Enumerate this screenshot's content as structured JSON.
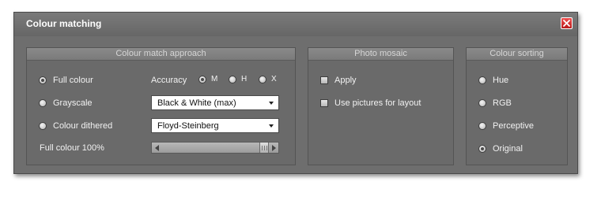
{
  "dialog": {
    "title": "Colour matching"
  },
  "approach": {
    "header": "Colour match approach",
    "options": [
      {
        "label": "Full colour",
        "checked": true
      },
      {
        "label": "Grayscale",
        "checked": false
      },
      {
        "label": "Colour dithered",
        "checked": false
      }
    ],
    "accuracy_label": "Accuracy",
    "accuracy_options": [
      {
        "label": "M",
        "checked": true
      },
      {
        "label": "H",
        "checked": false
      },
      {
        "label": "X",
        "checked": false
      }
    ],
    "grayscale_select_value": "Black & White (max)",
    "dither_select_value": "Floyd-Steinberg",
    "full_colour_label": "Full colour 100%",
    "full_colour_percent": 100
  },
  "mosaic": {
    "header": "Photo mosaic",
    "options": [
      {
        "label": "Apply",
        "checked": false
      },
      {
        "label": "Use pictures for layout",
        "checked": false
      }
    ]
  },
  "sorting": {
    "header": "Colour sorting",
    "options": [
      {
        "label": "Hue",
        "checked": false
      },
      {
        "label": "RGB",
        "checked": false
      },
      {
        "label": "Perceptive",
        "checked": false
      },
      {
        "label": "Original",
        "checked": true
      }
    ]
  },
  "icons": {
    "close": "close-icon"
  },
  "colors": {
    "dialog_bg": "#6e6e6e",
    "close_red": "#d93030"
  }
}
